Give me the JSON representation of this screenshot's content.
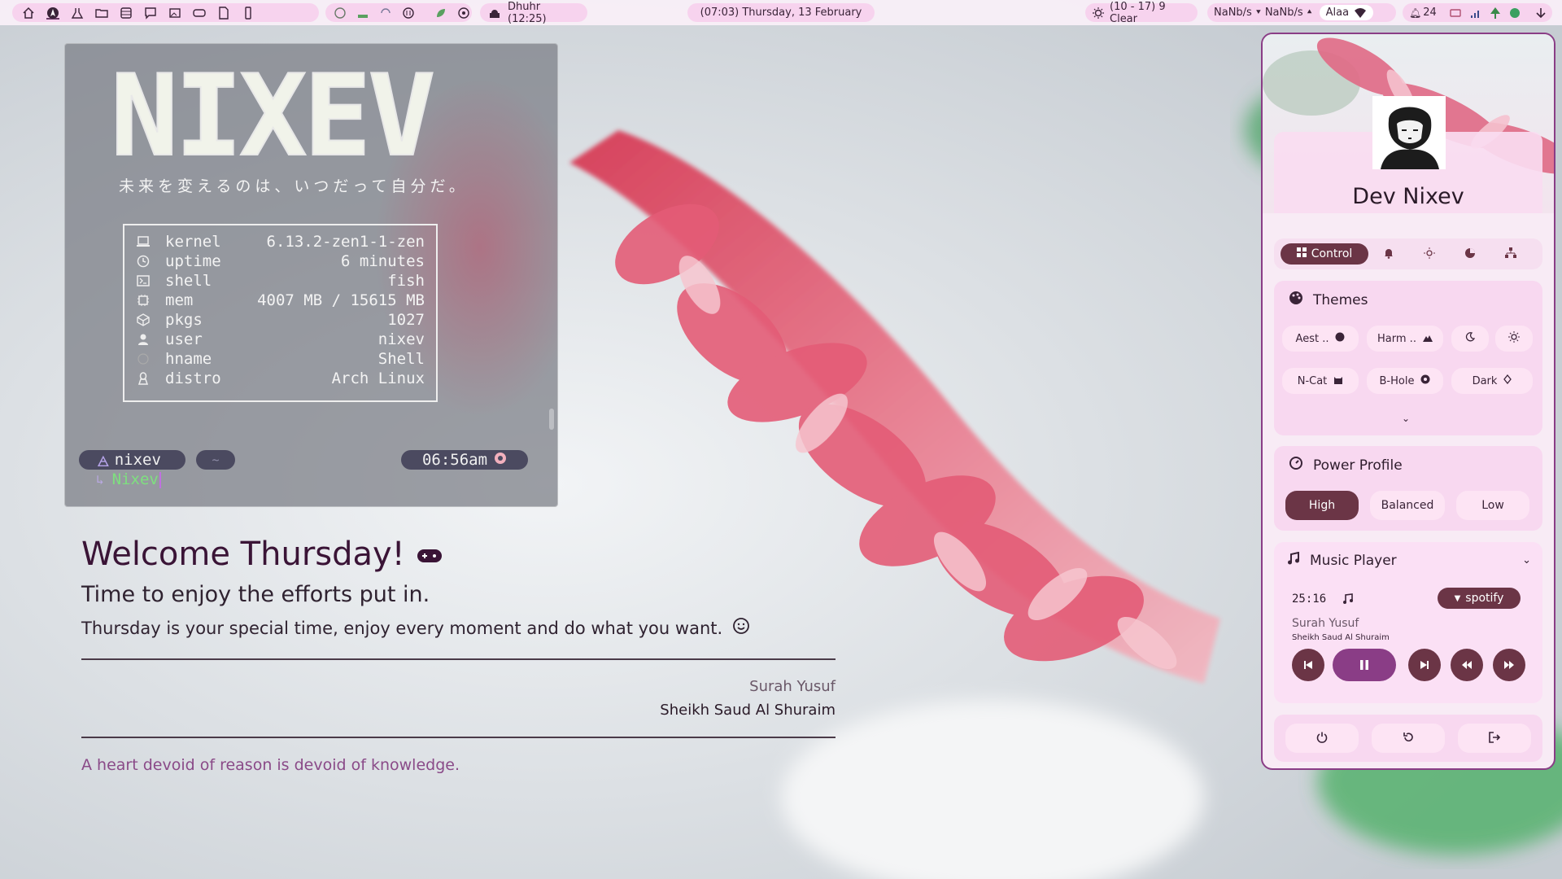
{
  "topbar": {
    "prayer": "Dhuhr (12:25)",
    "datetime": "(07:03) Thursday, 13 February",
    "weather": "(10 - 17) 9 Clear",
    "net_down": "NaNb/s",
    "net_up": "NaNb/s",
    "wifi_name": "Alaa",
    "notif_count": "24",
    "icons": [
      "home-icon",
      "arch-icon",
      "flask-icon",
      "folder-icon",
      "database-icon",
      "chat-icon",
      "image-icon",
      "gamepad-icon",
      "document-icon",
      "phone-icon",
      "pulse-icon",
      "tray-icon",
      "sync-icon",
      "audio-icon",
      "leaf-icon",
      "disc-icon",
      "sun-icon",
      "wifi-icon",
      "bell-icon",
      "battery-icon",
      "signal-icon",
      "power-icon",
      "download-icon"
    ]
  },
  "terminal": {
    "logo": "NIXEV",
    "motto": "未来を変えるのは、いつだって自分だ。",
    "sysinfo": [
      {
        "icon": "laptop-icon",
        "key": "kernel",
        "value": "6.13.2-zen1-1-zen"
      },
      {
        "icon": "clock-icon",
        "key": "uptime",
        "value": "6 minutes"
      },
      {
        "icon": "terminal-icon",
        "key": "shell",
        "value": "fish"
      },
      {
        "icon": "chip-icon",
        "key": "mem",
        "value": "4007 MB / 15615 MB"
      },
      {
        "icon": "package-icon",
        "key": "pkgs",
        "value": "1027"
      },
      {
        "icon": "user-icon",
        "key": "user",
        "value": "nixev"
      },
      {
        "icon": "circle-icon",
        "key": "hname",
        "value": "Shell"
      },
      {
        "icon": "linux-icon",
        "key": "distro",
        "value": "Arch Linux"
      }
    ],
    "prompt_user": "nixev",
    "prompt_dir": "~",
    "prompt_time": "06:56am",
    "command": "Nixev"
  },
  "welcome": {
    "title": "Welcome Thursday!",
    "subtitle": "Time to enjoy the efforts put in.",
    "description": "Thursday is your special time, enjoy every moment and do what you want.",
    "quote_title": "Surah Yusuf",
    "quote_author": "Sheikh Saud Al Shuraim",
    "quote_text": "A heart devoid of reason is devoid of knowledge."
  },
  "panel": {
    "name": "Dev Nixev",
    "tabs": {
      "active": "Control",
      "icons": [
        "bell-icon",
        "brightness-icon",
        "pie-icon",
        "network-icon"
      ]
    },
    "themes": {
      "title": "Themes",
      "items": [
        "Aest ..",
        "Harm ..",
        "",
        "",
        "N-Cat",
        "B-Hole",
        "Dark"
      ]
    },
    "power": {
      "title": "Power Profile",
      "options": [
        "High",
        "Balanced",
        "Low"
      ],
      "active": "High"
    },
    "music": {
      "title": "Music Player",
      "time": "25:16",
      "source": "spotify",
      "track": "Surah Yusuf",
      "artist": "Sheikh Saud Al Shuraim"
    },
    "colors": {
      "accent": "#6b3546",
      "border": "#8a3d86",
      "card": "#f8d8f0"
    }
  }
}
